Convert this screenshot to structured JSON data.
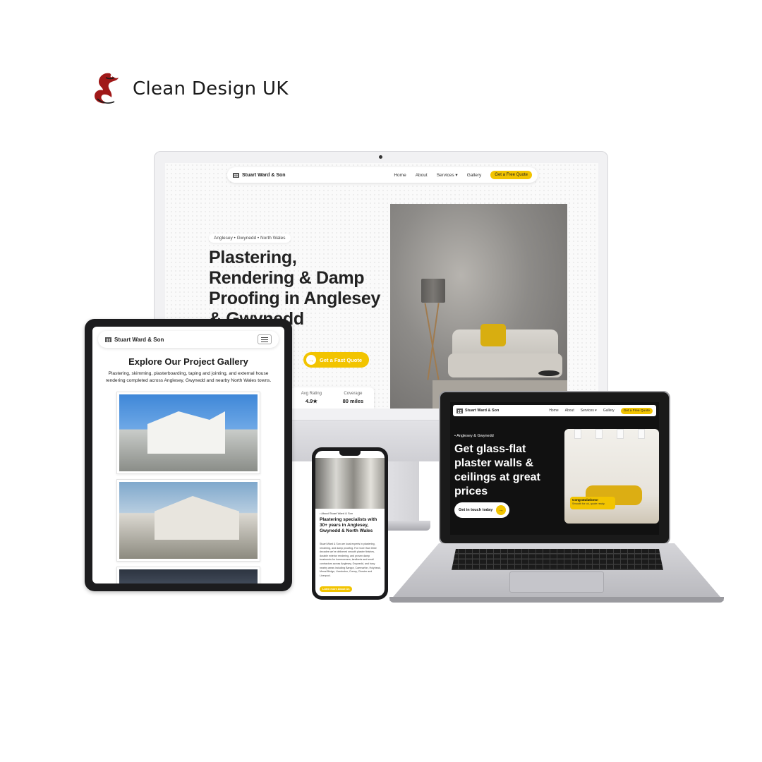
{
  "brand": {
    "name": "Clean Design UK",
    "logo": "red-dragon-logo"
  },
  "colors": {
    "accent": "#f2c400",
    "dark": "#111111",
    "text": "#222222"
  },
  "desktop": {
    "logo_text": "Stuart Ward & Son",
    "nav": [
      "Home",
      "About",
      "Services ▾",
      "Gallery"
    ],
    "nav_cta": "Get a Free Quote",
    "pill": "Anglesey • Gwynedd • North Wales",
    "headline": "Plastering, Rendering & Damp Proofing in Anglesey & Gwynedd",
    "cta": "Get a Fast Quote",
    "stats": [
      {
        "label": "Avg Rating",
        "value": "4.9★"
      },
      {
        "label": "Coverage",
        "value": "80 miles"
      }
    ]
  },
  "tablet": {
    "logo_text": "Stuart Ward & Son",
    "menu_icon": "hamburger-icon",
    "title": "Explore Our Project Gallery",
    "subtitle": "Plastering, skimming, plasterboarding, taping and jointing, and external house rendering completed across Anglesey, Gwynedd and nearby North Wales towns."
  },
  "phone": {
    "kicker": "• About Stuart Ward & Son",
    "headline": "Plastering specialists with 30+ years in Anglesey, Gwynedd & North Wales",
    "body": "Stuart Ward & Son are local experts in plastering, rendering, and damp proofing. For more than three decades we've delivered smooth plaster finishes, durable exterior rendering, and proven damp treatments for homeowners, landlords and small contractors across Anglesey, Gwynedd, and busy nearby areas including Bangor, Caernarfon, Holyhead, Menai Bridge, Llandudno, Conwy, Chester and Liverpool.",
    "cta": "Learn more About Us"
  },
  "laptop": {
    "logo_text": "Stuart Ward & Son",
    "nav": [
      "Home",
      "About",
      "Services ▾",
      "Gallery"
    ],
    "nav_cta": "Get a Free Quote",
    "kicker": "• Anglesey & Gwynedd",
    "headline": "Get glass-flat plaster walls & ceilings at great prices",
    "cta": "Get in touch today",
    "toast_title": "Congratulations!",
    "toast_text": "Smooth for ok, quote ready."
  }
}
